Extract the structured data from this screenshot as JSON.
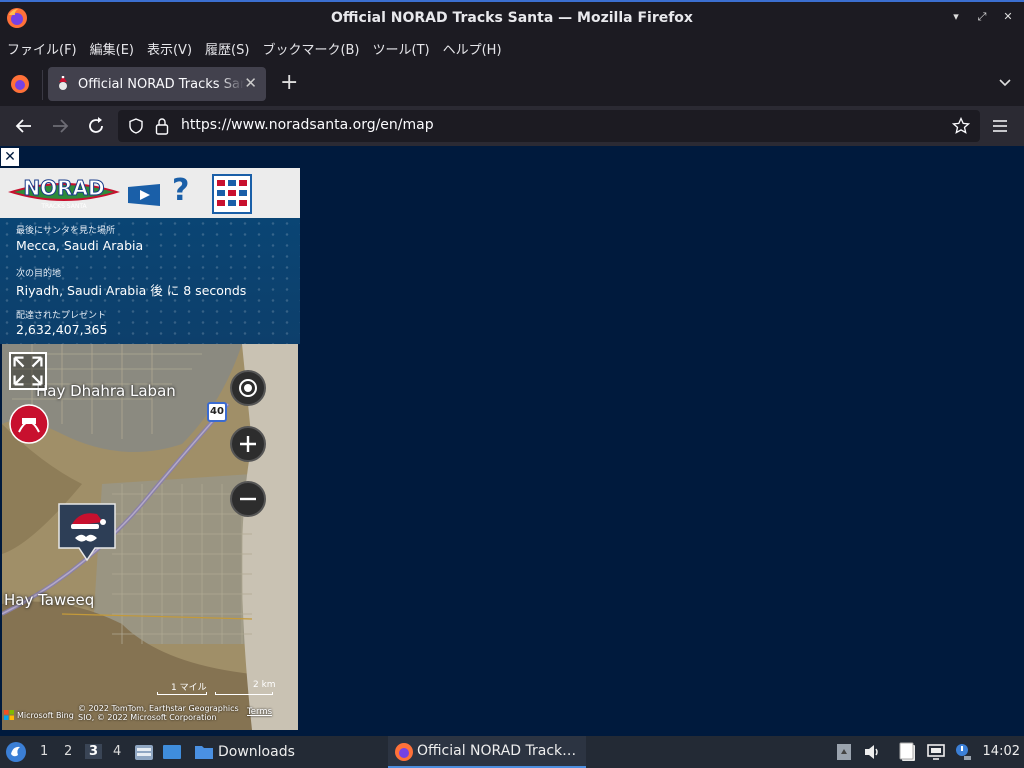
{
  "window": {
    "title": "Official NORAD Tracks Santa — Mozilla Firefox",
    "minimize": "▾",
    "maximize": "⤢",
    "close": "✕"
  },
  "menu": [
    "ファイル(F)",
    "編集(E)",
    "表示(V)",
    "履歴(S)",
    "ブックマーク(B)",
    "ツール(T)",
    "ヘルプ(H)"
  ],
  "tab": {
    "title": "Official NORAD Tracks Santa",
    "close": "✕",
    "new_tab": "+"
  },
  "nav": {
    "url": "https://www.noradsanta.org/en/map"
  },
  "panel": {
    "close": "✕",
    "help": "?",
    "last_seen_label": "最後にサンタを見た場所",
    "last_seen_value": "Mecca, Saudi Arabia",
    "next_label": "次の目的地",
    "next_value": "Riyadh, Saudi Arabia 後 に 8 seconds",
    "presents_label": "配達されたプレゼント",
    "presents_value": "2,632,407,365"
  },
  "map": {
    "place_1": "Hay Dhahra Laban",
    "place_2": "Hay Taweeq",
    "route": "40",
    "scale_miles": "1 マイル",
    "scale_km": "2 km",
    "attribution_1": "© 2022 TomTom, Earthstar Geographics",
    "attribution_2": "SIO, © 2022 Microsoft Corporation",
    "terms": "Terms",
    "bing": "Microsoft Bing"
  },
  "taskbar": {
    "workspaces": [
      "1",
      "2",
      "3",
      "4"
    ],
    "active_workspace": "3",
    "downloads": "Downloads",
    "active_task": "Official NORAD Track…",
    "clock": "14:02"
  },
  "colors": {
    "page_bg": "#001a3d",
    "accent": "#4d8fe0"
  }
}
